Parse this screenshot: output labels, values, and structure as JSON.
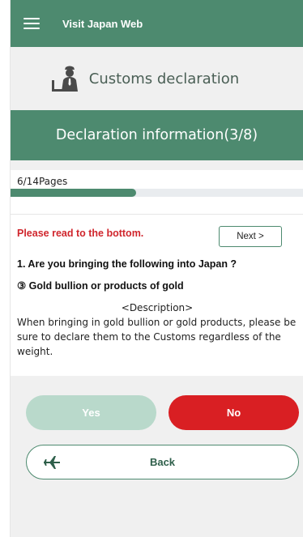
{
  "topbar": {
    "brand": "Visit Japan Web"
  },
  "header": {
    "title": "Customs declaration"
  },
  "section": {
    "title": "Declaration information(3/8)"
  },
  "progress": {
    "label": "6/14Pages",
    "fraction": 0.4286
  },
  "content": {
    "warning": "Please read to the bottom.",
    "next_label": "Next >",
    "question": "1. Are you bringing the following into Japan ?",
    "item": "③ Gold bullion or products of gold",
    "description_label": "<Description>",
    "description_text": "When bringing in gold bullion or gold products, please be sure to declare them to the Customs regardless of the weight."
  },
  "actions": {
    "yes_label": "Yes",
    "no_label": "No",
    "back_label": "Back"
  },
  "colors": {
    "brand_green": "#4d8a6f",
    "yes_disabled": "#b9d9cb",
    "no_red": "#d91f23",
    "warning_red": "#d0262d"
  },
  "icons": {
    "menu": "hamburger-icon",
    "customs": "customs-officer-icon",
    "back": "airplane-icon"
  }
}
